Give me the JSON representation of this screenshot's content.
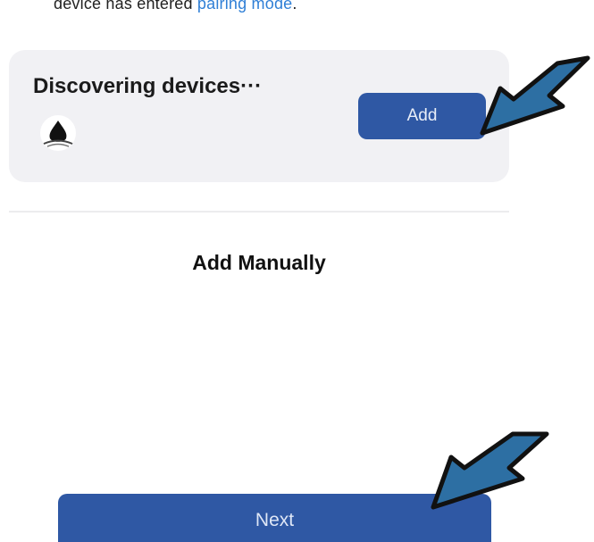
{
  "header": {
    "instruction_prefix": "device has entered ",
    "instruction_link": "pairing mode",
    "instruction_suffix": "."
  },
  "discovery": {
    "title": "Discovering devices···",
    "device_icon": "water-drop-device-icon",
    "add_label": "Add"
  },
  "manual": {
    "label": "Add Manually"
  },
  "footer": {
    "next_label": "Next"
  },
  "annotations": {
    "arrow_color": "#2d6fa3",
    "arrow_outline": "#111111"
  },
  "colors": {
    "primary_button": "#2f58a4",
    "card_background": "#f1f1f4",
    "link": "#2f7fd6"
  }
}
